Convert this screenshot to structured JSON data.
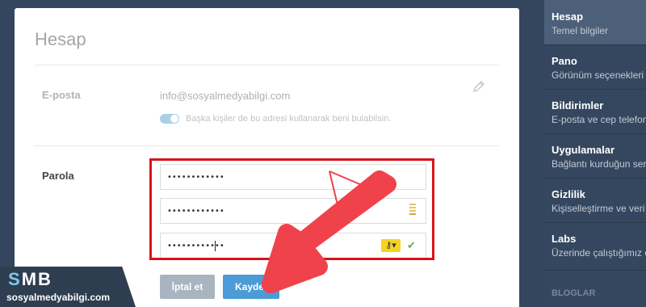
{
  "card": {
    "title": "Hesap",
    "email": {
      "label": "E-posta",
      "value": "info@sosyalmedyabilgi.com",
      "findable_text": "Başka kişiler de bu adresi kullanarak beni bulabilsin.",
      "findable_enabled": true
    },
    "password": {
      "label": "Parola",
      "current": "••••••••••••",
      "new": "••••••••••••",
      "confirm": "••••••••••••"
    },
    "buttons": {
      "cancel": "İptal et",
      "save": "Kaydet"
    }
  },
  "sidebar": {
    "items": [
      {
        "title": "Hesap",
        "subtitle": "Temel bilgiler",
        "active": true
      },
      {
        "title": "Pano",
        "subtitle": "Görünüm seçenekleri"
      },
      {
        "title": "Bildirimler",
        "subtitle": "E-posta ve cep telefonu"
      },
      {
        "title": "Uygulamalar",
        "subtitle": "Bağlantı kurduğun servisler"
      },
      {
        "title": "Gizlilik",
        "subtitle": "Kişiselleştirme ve veri"
      },
      {
        "title": "Labs",
        "subtitle": "Üzerinde çalıştığımız özellikler"
      }
    ],
    "section_heading": "BLOGLAR"
  },
  "watermark": {
    "logo_s": "S",
    "logo_m": "M",
    "logo_b": "B",
    "site": "sosyalmedyabilgi.com"
  },
  "colors": {
    "highlight": "#d7141a",
    "arrow": "#f0424b",
    "save": "#4a9bd6",
    "cancel": "#a8b4bf",
    "sidebar": "#35475f"
  }
}
